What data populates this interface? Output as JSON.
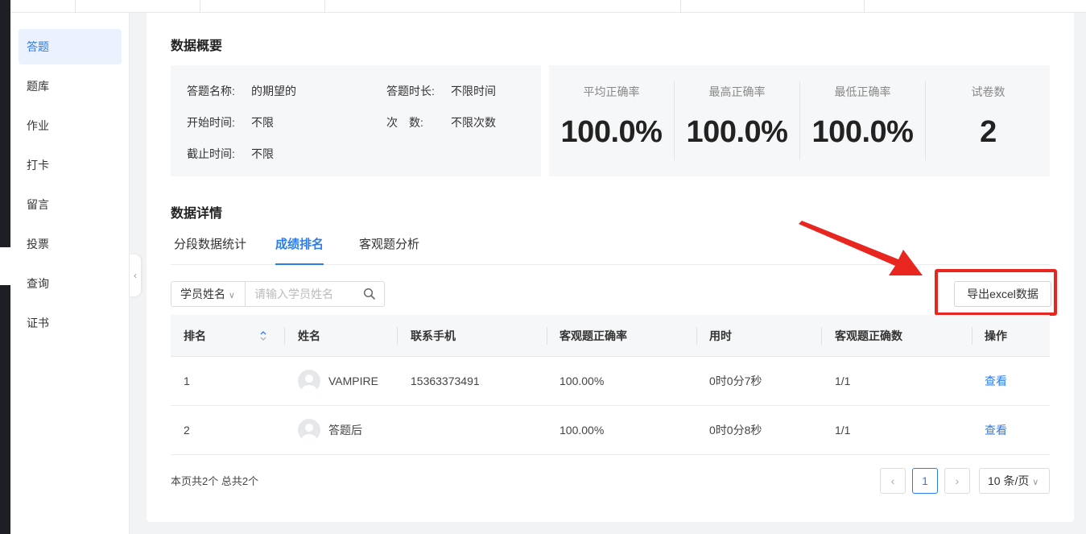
{
  "sidebar": {
    "items": [
      {
        "label": "答题",
        "active": true
      },
      {
        "label": "题库"
      },
      {
        "label": "作业"
      },
      {
        "label": "打卡"
      },
      {
        "label": "留言"
      },
      {
        "label": "投票"
      },
      {
        "label": "查询"
      },
      {
        "label": "证书"
      }
    ]
  },
  "overview": {
    "title": "数据概要",
    "info": {
      "name_label": "答题名称:",
      "name_value": "的期望的",
      "duration_label": "答题时长:",
      "duration_value": "不限时间",
      "start_label": "开始时间:",
      "start_value": "不限",
      "count_label": "次　数:",
      "count_value": "不限次数",
      "end_label": "截止时间:",
      "end_value": "不限"
    },
    "stats": [
      {
        "label": "平均正确率",
        "value": "100.0%"
      },
      {
        "label": "最高正确率",
        "value": "100.0%"
      },
      {
        "label": "最低正确率",
        "value": "100.0%"
      },
      {
        "label": "试卷数",
        "value": "2"
      }
    ]
  },
  "details": {
    "title": "数据详情",
    "tabs": [
      {
        "label": "分段数据统计"
      },
      {
        "label": "成绩排名",
        "active": true
      },
      {
        "label": "客观题分析"
      }
    ],
    "search": {
      "select_value": "学员姓名",
      "placeholder": "请输入学员姓名"
    },
    "export_label": "导出excel数据",
    "table": {
      "headers": [
        "排名",
        "姓名",
        "联系手机",
        "客观题正确率",
        "用时",
        "客观题正确数",
        "操作"
      ],
      "rows": [
        {
          "rank": "1",
          "name": "VAMPIRE",
          "phone": "15363373491",
          "rate": "100.00%",
          "time": "0时0分7秒",
          "correct": "1/1",
          "action": "查看"
        },
        {
          "rank": "2",
          "name": "答题后",
          "phone": "",
          "rate": "100.00%",
          "time": "0时0分8秒",
          "correct": "1/1",
          "action": "查看"
        }
      ]
    },
    "pagination": {
      "summary": "本页共2个 总共2个",
      "prev": "‹",
      "current": "1",
      "next": "›",
      "page_size": "10 条/页"
    }
  },
  "colors": {
    "accent": "#2b7de9",
    "highlight": "#e8261f"
  }
}
